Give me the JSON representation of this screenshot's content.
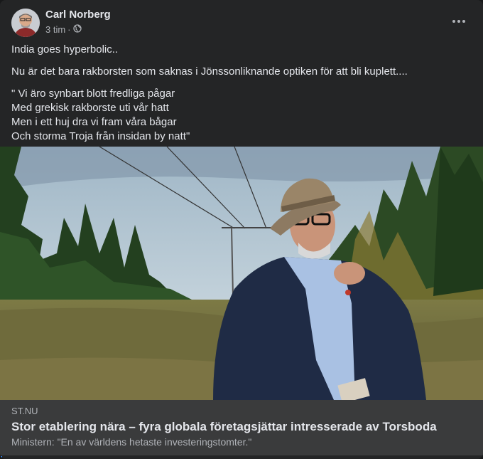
{
  "post": {
    "author": "Carl Norberg",
    "time": "3 tim",
    "separator": "·",
    "privacy_icon": "globe-icon",
    "options_icon": "more-options-icon",
    "text": {
      "line1": "India goes hyperbolic..",
      "line2": "Nu är det bara rakborsten som saknas i Jönssonliknande optiken för att bli kuplett....",
      "poem": "\" Vi äro synbart blott fredliga pågar\nMed grekisk rakborste uti vår hatt\nMen i ett huj dra vi fram våra bågar\nOch storma Troja från insidan by natt\""
    }
  },
  "link": {
    "domain": "ST.NU",
    "title": "Stor etablering nära – fyra globala företagsjättar intresserade av Torsboda",
    "subtitle": "Ministern: \"En av världens hetaste investeringstomter.\""
  },
  "colors": {
    "card_bg": "#242526",
    "link_bg": "#3a3b3c",
    "primary_text": "#e4e6eb",
    "secondary_text": "#b0b3b8",
    "accent": "#2d88ff"
  }
}
